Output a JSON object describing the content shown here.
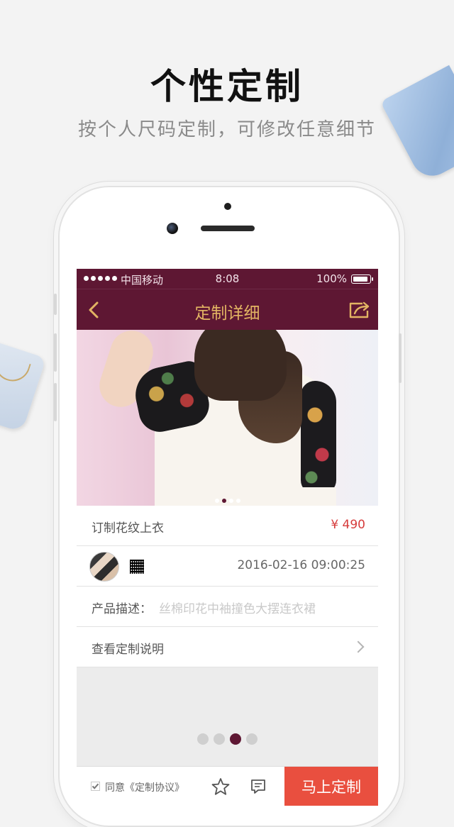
{
  "promo": {
    "title": "个性定制",
    "subtitle": "按个人尺码定制，可修改任意细节"
  },
  "status_bar": {
    "carrier": "中国移动",
    "time": "8:08",
    "battery": "100%"
  },
  "nav": {
    "title": "定制详细",
    "back_icon": "chevron-left-icon",
    "share_icon": "share-icon"
  },
  "product": {
    "name": "订制花纹上衣",
    "price": "¥ 490",
    "date": "2016-02-16  09:00:25",
    "description_label": "产品描述：",
    "description": "丝棉印花中袖撞色大摆连衣裙",
    "instructions_link": "查看定制说明",
    "image_pager": {
      "count": 4,
      "active": 2
    }
  },
  "page_pager": {
    "count": 4,
    "active": 3
  },
  "bottom_bar": {
    "agree_label": "同意《定制协议》",
    "agree_checked": true,
    "customize_button": "马上定制"
  },
  "colors": {
    "brand": "#5e1733",
    "title_gold": "#e2b463",
    "price_red": "#d63b3b",
    "action": "#e94f3f"
  }
}
